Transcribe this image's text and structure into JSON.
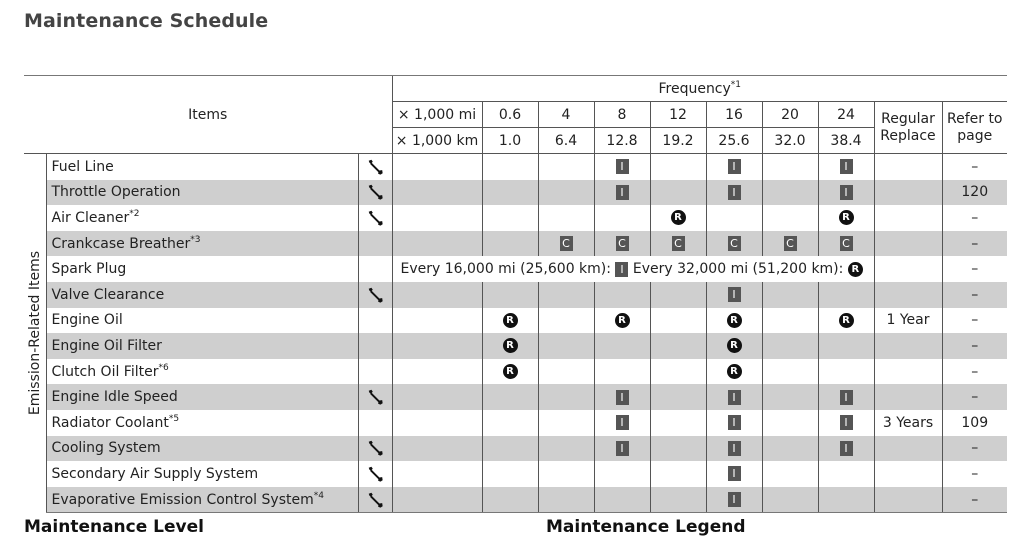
{
  "page_title": "Maintenance Schedule",
  "header": {
    "items_label": "Items",
    "frequency_label": "Frequency",
    "frequency_note": "*1",
    "unit_mi": "× 1,000 mi",
    "unit_km": "× 1,000 km",
    "mi_values": [
      "0.6",
      "4",
      "8",
      "12",
      "16",
      "20",
      "24"
    ],
    "km_values": [
      "1.0",
      "6.4",
      "12.8",
      "19.2",
      "25.6",
      "32.0",
      "38.4"
    ],
    "regular_replace": [
      "Regular",
      "Replace"
    ],
    "refer_to_page": [
      "Refer to",
      "page"
    ]
  },
  "group_label": "Emission-Related Items",
  "legend_symbols": {
    "I": "I",
    "C": "C",
    "R": "R",
    "wrench": "wrench-icon"
  },
  "rows": [
    {
      "name": "Fuel Line",
      "note": "",
      "wrench": true,
      "cells": [
        "",
        "",
        "I",
        "",
        "I",
        "",
        "I"
      ],
      "regular": "",
      "page": "–"
    },
    {
      "name": "Throttle Operation",
      "note": "",
      "wrench": true,
      "cells": [
        "",
        "",
        "I",
        "",
        "I",
        "",
        "I"
      ],
      "regular": "",
      "page": "120"
    },
    {
      "name": "Air Cleaner",
      "note": "*2",
      "wrench": true,
      "cells": [
        "",
        "",
        "",
        "R",
        "",
        "",
        "R"
      ],
      "regular": "",
      "page": "–"
    },
    {
      "name": "Crankcase Breather",
      "note": "*3",
      "wrench": false,
      "cells": [
        "",
        "C",
        "C",
        "C",
        "C",
        "C",
        "C"
      ],
      "regular": "",
      "page": "–"
    },
    {
      "name": "Spark Plug",
      "note": "",
      "wrench": false,
      "span_text_1": "Every 16,000 mi (25,600 km):",
      "span_mark_1": "I",
      "span_text_2": "Every 32,000 mi (51,200 km):",
      "span_mark_2": "R",
      "regular": "",
      "page": "–"
    },
    {
      "name": "Valve Clearance",
      "note": "",
      "wrench": true,
      "cells": [
        "",
        "",
        "",
        "",
        "I",
        "",
        ""
      ],
      "regular": "",
      "page": "–"
    },
    {
      "name": "Engine Oil",
      "note": "",
      "wrench": false,
      "cells": [
        "R",
        "",
        "R",
        "",
        "R",
        "",
        "R"
      ],
      "regular": "1 Year",
      "page": "–"
    },
    {
      "name": "Engine Oil Filter",
      "note": "",
      "wrench": false,
      "cells": [
        "R",
        "",
        "",
        "",
        "R",
        "",
        ""
      ],
      "regular": "",
      "page": "–"
    },
    {
      "name": "Clutch Oil Filter",
      "note": "*6",
      "wrench": false,
      "cells": [
        "R",
        "",
        "",
        "",
        "R",
        "",
        ""
      ],
      "regular": "",
      "page": "–"
    },
    {
      "name": "Engine Idle Speed",
      "note": "",
      "wrench": true,
      "cells": [
        "",
        "",
        "I",
        "",
        "I",
        "",
        "I"
      ],
      "regular": "",
      "page": "–"
    },
    {
      "name": "Radiator Coolant",
      "note": "*5",
      "wrench": false,
      "cells": [
        "",
        "",
        "I",
        "",
        "I",
        "",
        "I"
      ],
      "regular": "3 Years",
      "page": "109"
    },
    {
      "name": "Cooling System",
      "note": "",
      "wrench": true,
      "cells": [
        "",
        "",
        "I",
        "",
        "I",
        "",
        "I"
      ],
      "regular": "",
      "page": "–"
    },
    {
      "name": "Secondary Air Supply System",
      "note": "",
      "wrench": true,
      "cells": [
        "",
        "",
        "",
        "",
        "I",
        "",
        ""
      ],
      "regular": "",
      "page": "–"
    },
    {
      "name": "Evaporative Emission Control System",
      "note": "*4",
      "wrench": true,
      "cells": [
        "",
        "",
        "",
        "",
        "I",
        "",
        ""
      ],
      "regular": "",
      "page": "–"
    }
  ],
  "footer": {
    "left_heading": "Maintenance Level",
    "right_heading": "Maintenance Legend"
  }
}
